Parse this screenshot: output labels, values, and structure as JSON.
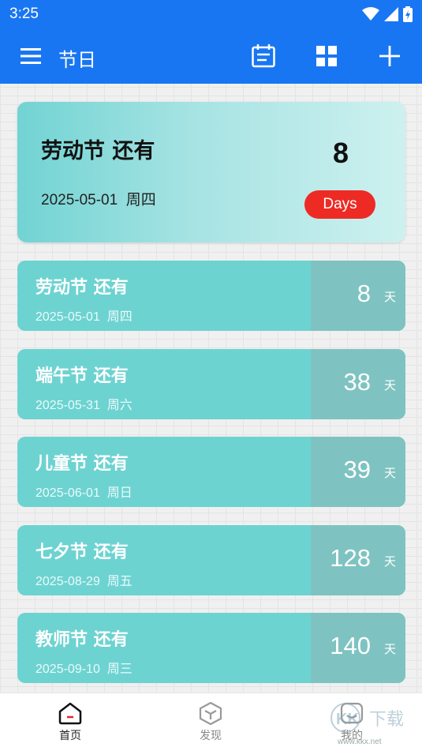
{
  "status_bar": {
    "time": "3:25"
  },
  "app_bar": {
    "title": "节日"
  },
  "hero": {
    "title": "劳动节 还有",
    "date": "2025-05-01  周四",
    "count": "8",
    "badge": "Days"
  },
  "items": [
    {
      "title": "劳动节 还有",
      "date": "2025-05-01  周四",
      "count": "8",
      "unit": "天"
    },
    {
      "title": "端午节 还有",
      "date": "2025-05-31  周六",
      "count": "38",
      "unit": "天"
    },
    {
      "title": "儿童节 还有",
      "date": "2025-06-01  周日",
      "count": "39",
      "unit": "天"
    },
    {
      "title": "七夕节 还有",
      "date": "2025-08-29  周五",
      "count": "128",
      "unit": "天"
    },
    {
      "title": "教师节 还有",
      "date": "2025-09-10  周三",
      "count": "140",
      "unit": "天"
    }
  ],
  "bottom_nav": {
    "items": [
      {
        "label": "首页",
        "icon": "home-icon",
        "active": true
      },
      {
        "label": "发现",
        "icon": "cube-icon",
        "active": false
      },
      {
        "label": "我的",
        "icon": "profile-icon",
        "active": false
      }
    ]
  },
  "watermark": {
    "text": "www.kkx.net",
    "logo_text": "KK下载"
  },
  "colors": {
    "primary": "#1976f2",
    "card_teal": "#6dd3d1",
    "card_right": "#7ec3c1",
    "badge_red": "#ee2a24"
  }
}
